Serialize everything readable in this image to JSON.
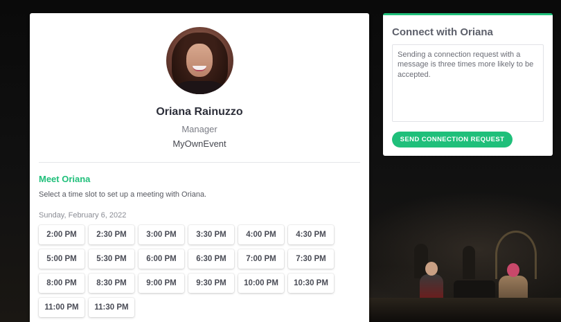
{
  "profile": {
    "name": "Oriana Rainuzzo",
    "role": "Manager",
    "company": "MyOwnEvent",
    "avatar": "profile-photo"
  },
  "meeting": {
    "title": "Meet Oriana",
    "description": "Select a time slot to set up a meeting with Oriana.",
    "date": "Sunday, February 6, 2022",
    "slots": [
      "2:00 PM",
      "2:30 PM",
      "3:00 PM",
      "3:30 PM",
      "4:00 PM",
      "4:30 PM",
      "5:00 PM",
      "5:30 PM",
      "6:00 PM",
      "6:30 PM",
      "7:00 PM",
      "7:30 PM",
      "8:00 PM",
      "8:30 PM",
      "9:00 PM",
      "9:30 PM",
      "10:00 PM",
      "10:30 PM",
      "11:00 PM",
      "11:30 PM"
    ]
  },
  "connect": {
    "title": "Connect with Oriana",
    "message_placeholder": "Sending a connection request with a message is three times more likely to be accepted.",
    "message_value": "",
    "button_label": "SEND CONNECTION REQUEST"
  },
  "colors": {
    "accent": "#1fbf7a",
    "background": "#0b0b0b",
    "card": "#ffffff"
  }
}
